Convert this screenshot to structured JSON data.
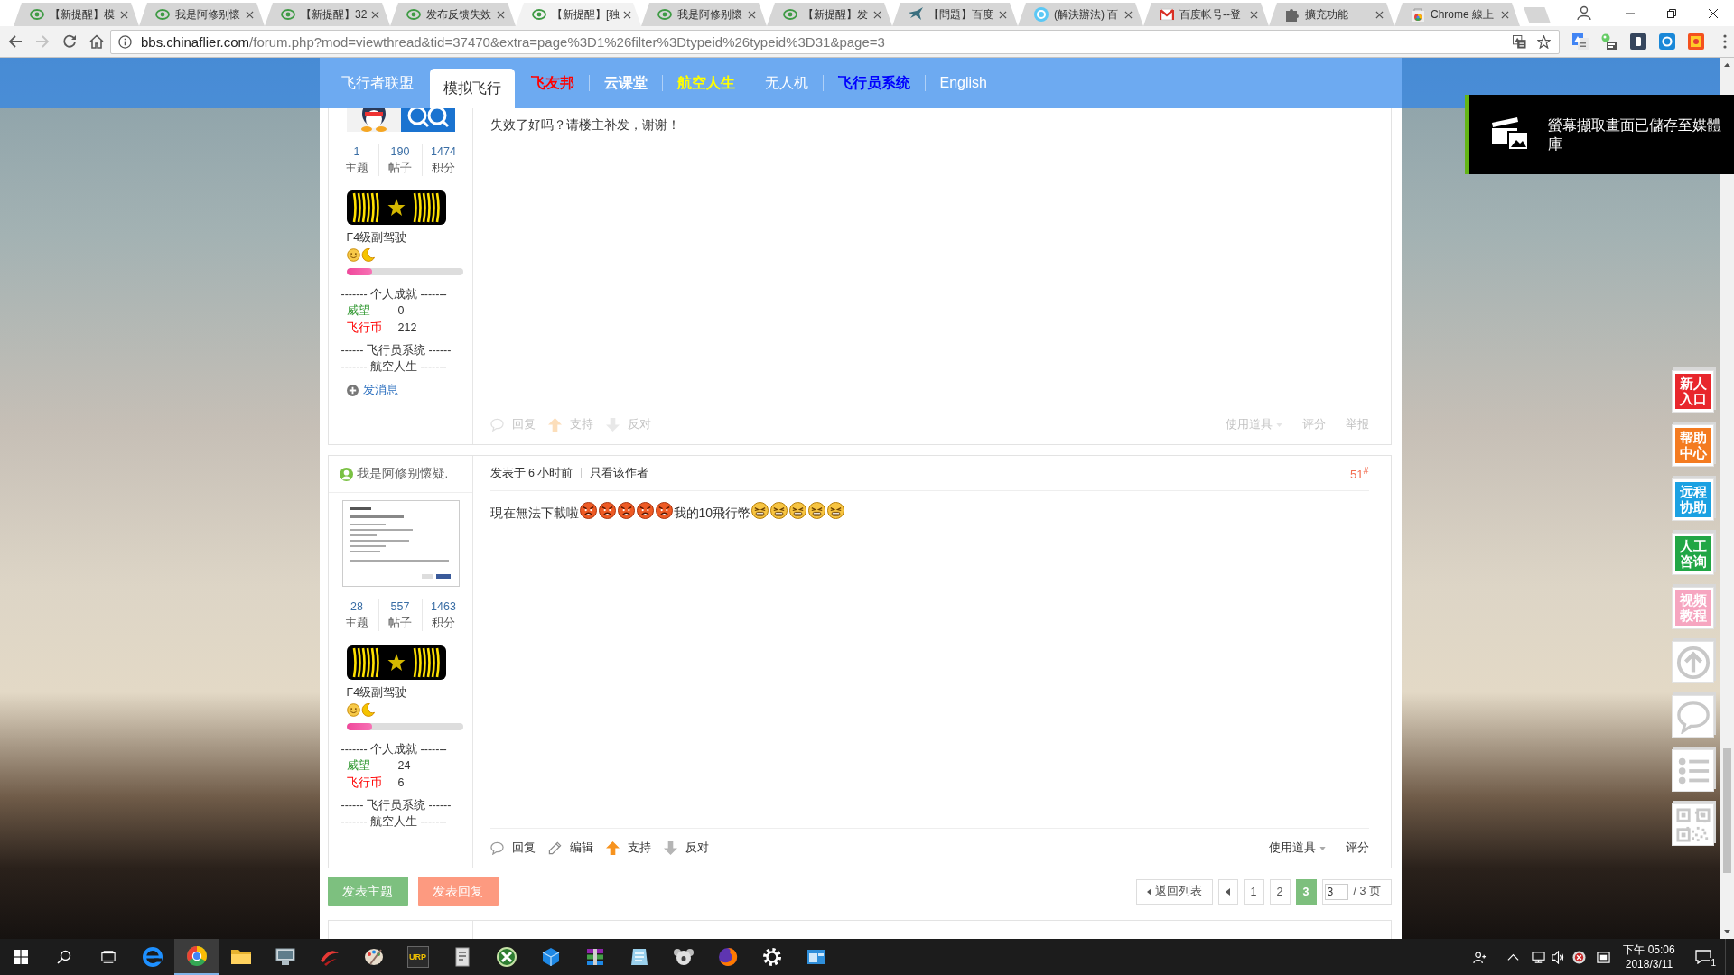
{
  "browser": {
    "tabs": [
      {
        "title": "【新提醒】模",
        "kind": "forum",
        "selected": false
      },
      {
        "title": "我是阿修别懷",
        "kind": "forum",
        "selected": false
      },
      {
        "title": "【新提醒】32",
        "kind": "forum",
        "selected": false
      },
      {
        "title": "发布反馈失效",
        "kind": "forum",
        "selected": false
      },
      {
        "title": "【新提醒】[独",
        "kind": "forum",
        "selected": true
      },
      {
        "title": "我是阿修别懷",
        "kind": "forum",
        "selected": false
      },
      {
        "title": "【新提醒】发",
        "kind": "forum",
        "selected": false
      },
      {
        "title": "【問題】百度",
        "kind": "bird",
        "selected": false
      },
      {
        "title": "(解決辦法) 百",
        "kind": "circle",
        "selected": false
      },
      {
        "title": "百度帐号--登",
        "kind": "mail",
        "selected": false
      },
      {
        "title": "擴充功能",
        "kind": "puzzle",
        "selected": false
      },
      {
        "title": "Chrome 線上",
        "kind": "store",
        "selected": false
      }
    ],
    "nav_buttons": [
      {
        "kind": "back",
        "disabled": false
      },
      {
        "kind": "forward",
        "disabled": true
      },
      {
        "kind": "reload",
        "disabled": false
      },
      {
        "kind": "home",
        "disabled": false
      }
    ],
    "address": {
      "domain": "bbs.chinaflier.com",
      "path": "/forum.php?mod=viewthread&tid=37470&extra=page%3D1%26filter%3Dtypeid%26typeid%3D31&page=3"
    },
    "extensions": [
      {
        "kind": "translate"
      },
      {
        "kind": "script"
      },
      {
        "kind": "tumblr"
      },
      {
        "kind": "pocket"
      },
      {
        "kind": "photo"
      }
    ]
  },
  "nav": [
    {
      "label": "飞行者联盟",
      "color": "#ffffff",
      "bold": false,
      "selected": false
    },
    {
      "label": "模拟飞行",
      "color": "#333333",
      "bold": false,
      "selected": true
    },
    {
      "label": "飞友邦",
      "color": "#ff0000",
      "bold": true,
      "selected": false
    },
    {
      "label": "云课堂",
      "color": "#ffffff",
      "bold": true,
      "selected": false
    },
    {
      "label": "航空人生",
      "color": "#ffff00",
      "bold": true,
      "selected": false
    },
    {
      "label": "无人机",
      "color": "#ffffff",
      "bold": false,
      "selected": false
    },
    {
      "label": "飞行员系统",
      "color": "#0000ff",
      "bold": true,
      "selected": false
    },
    {
      "label": "English",
      "color": "#ffffff",
      "bold": false,
      "selected": false
    }
  ],
  "posts": [
    {
      "avatar": {
        "kind": "logo"
      },
      "stats": [
        {
          "value": "1",
          "label": "主题"
        },
        {
          "value": "190",
          "label": "帖子"
        },
        {
          "value": "1474",
          "label": "积分"
        }
      ],
      "rank": "F4级副驾驶",
      "level": 0.22,
      "achievements": "------- 个人成就 -------",
      "credits": [
        {
          "label": "威望",
          "value": "0",
          "color": "#339933"
        },
        {
          "label": "飞行币",
          "value": "212",
          "color": "#ff0000"
        }
      ],
      "sections": [
        "------ 飞行员系统 ------",
        "------- 航空人生 -------"
      ],
      "message_link": "发消息",
      "body": [
        {
          "kind": "text",
          "text": "失效了好吗？请楼主补发，谢谢！"
        }
      ],
      "dimmed": true,
      "actions": [
        {
          "kind": "reply",
          "label": "回复"
        },
        {
          "kind": "support",
          "label": "支持"
        },
        {
          "kind": "oppose",
          "label": "反对"
        }
      ],
      "tools": [
        {
          "kind": "menu",
          "label": "使用道具"
        },
        {
          "kind": "rate",
          "label": "评分"
        },
        {
          "kind": "report",
          "label": "举报"
        }
      ]
    },
    {
      "author": {
        "name": "我是阿修别懷疑.",
        "online": true
      },
      "avatar": {
        "kind": "screenshot"
      },
      "stats": [
        {
          "value": "28",
          "label": "主题"
        },
        {
          "value": "557",
          "label": "帖子"
        },
        {
          "value": "1463",
          "label": "积分"
        }
      ],
      "rank": "F4级副驾驶",
      "level": 0.22,
      "achievements": "------- 个人成就 -------",
      "credits": [
        {
          "label": "威望",
          "value": "24",
          "color": "#339933"
        },
        {
          "label": "飞行币",
          "value": "6",
          "color": "#ff0000"
        }
      ],
      "sections": [
        "------ 飞行员系统 ------",
        "------- 航空人生 -------"
      ],
      "meta": {
        "time": "发表于 6 小时前",
        "author_only": "只看该作者",
        "floor": "51$^{#}$"
      },
      "body": [
        {
          "kind": "text",
          "text": "現在無法下載啦"
        },
        {
          "kind": "angry"
        },
        {
          "kind": "angry"
        },
        {
          "kind": "angry"
        },
        {
          "kind": "angry"
        },
        {
          "kind": "angry"
        },
        {
          "kind": "text",
          "text": "我的10飛行幣"
        },
        {
          "kind": "tired"
        },
        {
          "kind": "tired"
        },
        {
          "kind": "tired"
        },
        {
          "kind": "tired"
        },
        {
          "kind": "tired"
        }
      ],
      "dimmed": false,
      "actions": [
        {
          "kind": "reply",
          "label": "回复"
        },
        {
          "kind": "edit",
          "label": "编辑"
        },
        {
          "kind": "support",
          "label": "支持"
        },
        {
          "kind": "oppose",
          "label": "反对"
        }
      ],
      "tools": [
        {
          "kind": "menu",
          "label": "使用道具"
        },
        {
          "kind": "rate",
          "label": "评分"
        }
      ]
    }
  ],
  "post_buttons": [
    {
      "kind": "thread",
      "label": "发表主题"
    },
    {
      "kind": "reply",
      "label": "发表回复"
    }
  ],
  "pagination": {
    "back": "返回列表",
    "pages": [
      {
        "label": "1",
        "selected": false
      },
      {
        "label": "2",
        "selected": false
      },
      {
        "label": "3",
        "selected": true
      }
    ],
    "input": "3",
    "total": "/ 3 页"
  },
  "notification": {
    "text": "螢幕擷取畫面已儲存至媒體庫"
  },
  "side_toolbar": [
    {
      "kind": "label",
      "label": "新人入口",
      "color": "#e8262c"
    },
    {
      "kind": "label",
      "label": "帮助中心",
      "color": "#f47b20"
    },
    {
      "kind": "label",
      "label": "远程协助",
      "color": "#1ba1e2"
    },
    {
      "kind": "label",
      "label": "人工咨询",
      "color": "#21a645"
    },
    {
      "kind": "label",
      "label": "视频教程",
      "color": "#f6a5c0"
    },
    {
      "kind": "top"
    },
    {
      "kind": "chat"
    },
    {
      "kind": "list"
    },
    {
      "kind": "qr"
    }
  ],
  "taskbar": {
    "apps": [
      {
        "kind": "edge",
        "active": false
      },
      {
        "kind": "chrome",
        "active": true
      },
      {
        "kind": "folder",
        "active": false
      },
      {
        "kind": "monitor",
        "active": false
      },
      {
        "kind": "swoosh",
        "active": false
      },
      {
        "kind": "palette",
        "active": false
      },
      {
        "kind": "urp",
        "label": "URP",
        "active": false
      },
      {
        "kind": "document",
        "active": false
      },
      {
        "kind": "xcircle",
        "active": false
      },
      {
        "kind": "cube",
        "active": false
      },
      {
        "kind": "books",
        "active": false
      },
      {
        "kind": "notepad",
        "active": false
      },
      {
        "kind": "koala",
        "active": false
      },
      {
        "kind": "firefox",
        "active": false
      },
      {
        "kind": "gear",
        "active": false
      },
      {
        "kind": "window",
        "active": false
      }
    ],
    "time": "下午 05:06",
    "date": "2018/3/11",
    "notification_count": "1"
  }
}
